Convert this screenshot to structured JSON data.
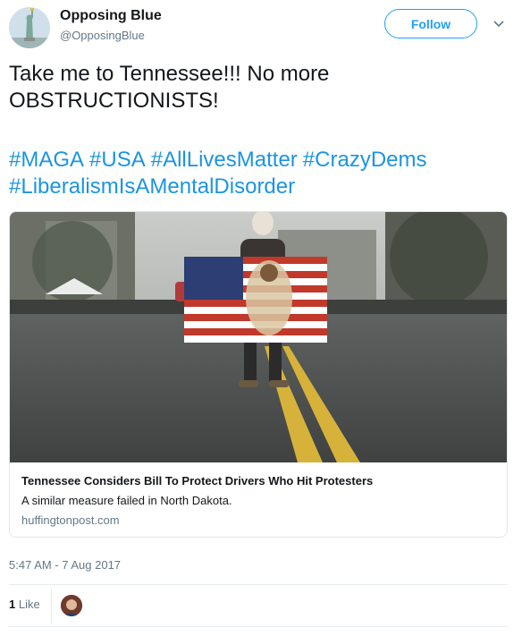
{
  "user": {
    "name": "Opposing Blue",
    "handle": "@OpposingBlue",
    "follow_label": "Follow"
  },
  "tweet": {
    "text_line1": "Take me to Tennessee!!! No more",
    "text_line2": "OBSTRUCTIONISTS!",
    "hashtags": [
      "#MAGA",
      "#USA",
      "#AllLivesMatter",
      "#CrazyDems",
      "#LiberalismIsAMentalDisorder"
    ]
  },
  "card": {
    "title": "Tennessee Considers Bill To Protect Drivers Who Hit Protesters",
    "description": "A similar measure failed in North Dakota.",
    "domain": "huffingtonpost.com"
  },
  "timestamp": "5:47 AM - 7 Aug 2017",
  "stats": {
    "likes_count": "1",
    "likes_label": "Like"
  },
  "colors": {
    "accent": "#1da1f2",
    "hashtag": "#1b95e0",
    "secondary_text": "#657786"
  },
  "icons": {
    "avatar": "statue-of-liberty-avatar",
    "caret": "chevron-down-icon",
    "liker": "liker-avatar"
  }
}
